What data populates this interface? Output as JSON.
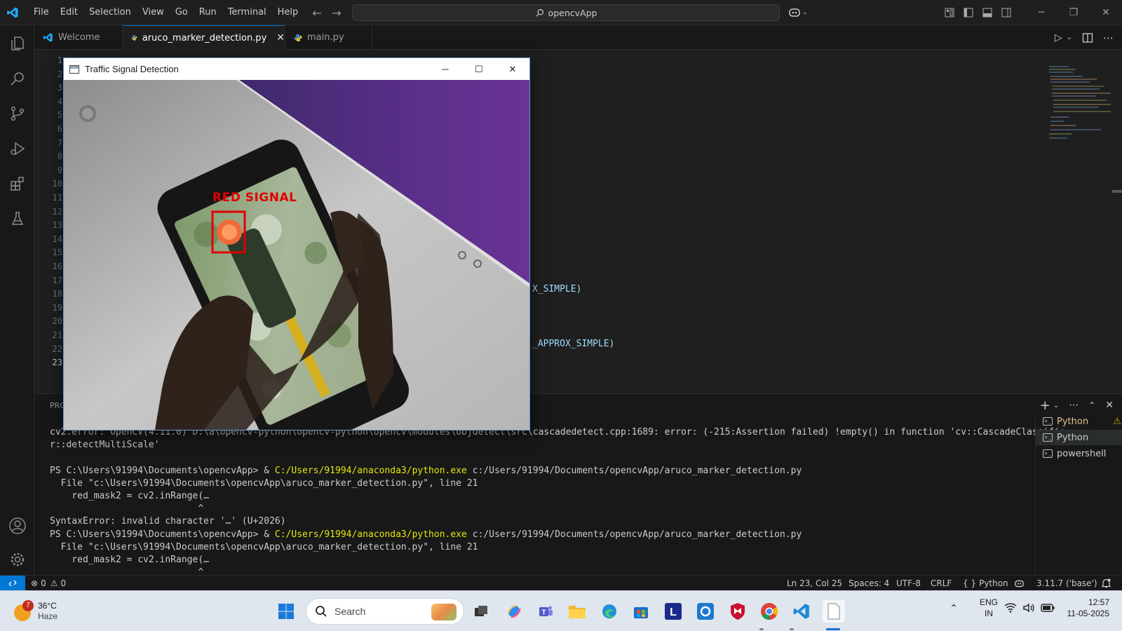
{
  "titlebar": {
    "menu": [
      "File",
      "Edit",
      "Selection",
      "View",
      "Go",
      "Run",
      "Terminal",
      "Help"
    ],
    "command_center": "opencvApp"
  },
  "tabs": [
    {
      "label": "Welcome"
    },
    {
      "label": "aruco_marker_detection.py"
    },
    {
      "label": "main.py"
    }
  ],
  "editor": {
    "line_numbers": [
      "1",
      "2",
      "3",
      "4",
      "5",
      "6",
      "7",
      "8",
      "9",
      "10",
      "11",
      "12",
      "13",
      "14",
      "15",
      "16",
      "17",
      "18",
      "19",
      "20",
      "21",
      "22",
      "23"
    ],
    "visible_code": [
      {
        "text": "X_SIMPLE)"
      },
      {
        "text": "_APPROX_SIMPLE)"
      }
    ]
  },
  "popup": {
    "title": "Traffic Signal Detection",
    "detection_label": "RED SIGNAL"
  },
  "panel": {
    "tab_label": "PROBLEMS",
    "terminal_lines": [
      {
        "text": "cv2.error: OpenCV(4.11.0) D:\\a\\opencv-python\\opencv-python\\opencv\\modules\\objdetect\\src\\cascadedetect.cpp:1689: error: (-215:Assertion failed) !empty() in function 'cv::CascadeClassifie"
      },
      {
        "text": "r::detectMultiScale'"
      },
      {
        "text": ""
      },
      {
        "prompt": "PS C:\\Users\\91994\\Documents\\opencvApp> & ",
        "exe": "C:/Users/91994/anaconda3/python.exe",
        "arg": " c:/Users/91994/Documents/opencvApp/aruco_marker_detection.py"
      },
      {
        "text": "  File \"c:\\Users\\91994\\Documents\\opencvApp\\aruco_marker_detection.py\", line 21"
      },
      {
        "text": "    red_mask2 = cv2.inRange(…"
      },
      {
        "text": "                           ^"
      },
      {
        "text": "SyntaxError: invalid character '…' (U+2026)"
      },
      {
        "prompt": "PS C:\\Users\\91994\\Documents\\opencvApp> & ",
        "exe": "C:/Users/91994/anaconda3/python.exe",
        "arg": " c:/Users/91994/Documents/opencvApp/aruco_marker_detection.py"
      },
      {
        "text": "  File \"c:\\Users\\91994\\Documents\\opencvApp\\aruco_marker_detection.py\", line 21"
      },
      {
        "text": "    red_mask2 = cv2.inRange(…"
      },
      {
        "text": "                           ^"
      }
    ],
    "terminals": [
      "Python",
      "Python",
      "powershell"
    ]
  },
  "statusbar": {
    "errors": "0",
    "warnings": "0",
    "position": "Ln 23, Col 25",
    "spaces": "Spaces: 4",
    "encoding": "UTF-8",
    "eol": "CRLF",
    "language": "Python",
    "interpreter": "3.11.7 ('base')"
  },
  "taskbar": {
    "weather_temp": "36°C",
    "weather_desc": "Haze",
    "weather_badge": "7",
    "search_label": "Search",
    "lang_top": "ENG",
    "lang_bottom": "IN",
    "time": "12:57",
    "date": "11-05-2025"
  },
  "colors": {
    "accent": "#0078d4",
    "detection_red": "#e00000",
    "terminal_yellow": "#e5e510"
  }
}
